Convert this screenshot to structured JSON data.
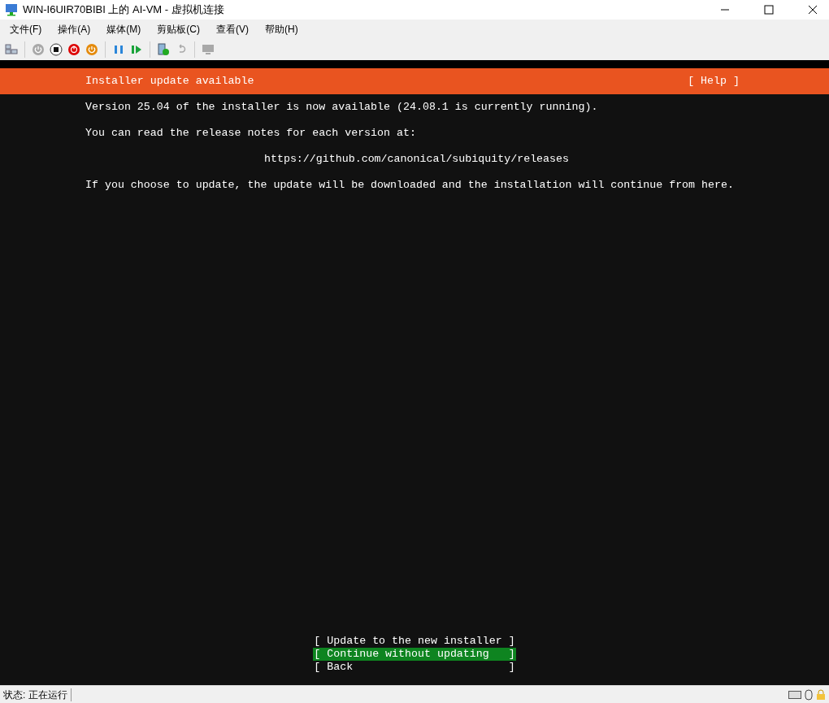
{
  "window": {
    "title": "WIN-I6UIR70BIBI 上的 AI-VM - 虚拟机连接"
  },
  "menu": [
    "文件(F)",
    "操作(A)",
    "媒体(M)",
    "剪贴板(C)",
    "查看(V)",
    "帮助(H)"
  ],
  "toolbar": [
    {
      "kind": "ctrl",
      "disabled": false
    },
    {
      "kind": "sep"
    },
    {
      "kind": "start",
      "disabled": true
    },
    {
      "kind": "stop",
      "disabled": false
    },
    {
      "kind": "shutdown",
      "disabled": false
    },
    {
      "kind": "power",
      "disabled": false
    },
    {
      "kind": "sep"
    },
    {
      "kind": "pause",
      "disabled": false
    },
    {
      "kind": "resume",
      "disabled": false
    },
    {
      "kind": "sep"
    },
    {
      "kind": "checkpoint",
      "disabled": false
    },
    {
      "kind": "revert",
      "disabled": true
    },
    {
      "kind": "sep"
    },
    {
      "kind": "enhanced",
      "disabled": true
    }
  ],
  "installer": {
    "header": "Installer update available",
    "help": "[ Help ]",
    "lines": [
      {
        "text": "Version 25.04 of the installer is now available (24.08.1 is currently running).",
        "centered": false
      },
      {
        "text": "You can read the release notes for each version at:",
        "centered": false
      },
      {
        "text": "https://github.com/canonical/subiquity/releases",
        "centered": true
      },
      {
        "text": "If you choose to update, the update will be downloaded and the installation will continue from here.",
        "centered": false
      }
    ],
    "options": [
      {
        "label": "[ Update to the new installer ]",
        "selected": false
      },
      {
        "label": "[ Continue without updating   ]",
        "selected": true
      },
      {
        "label": "[ Back                        ]",
        "selected": false
      }
    ]
  },
  "status_bar": {
    "status": "状态: 正在运行"
  }
}
